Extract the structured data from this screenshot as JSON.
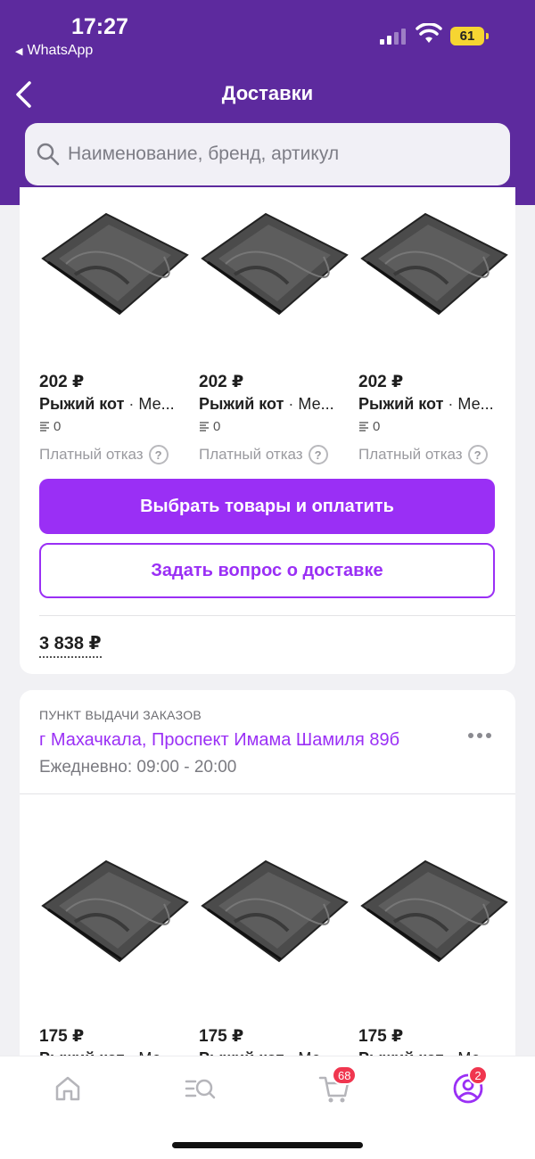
{
  "status_bar": {
    "time": "17:27",
    "back_app": "WhatsApp",
    "battery": "61"
  },
  "header": {
    "title": "Доставки"
  },
  "search": {
    "placeholder": "Наименование, бренд, артикул"
  },
  "delivery1": {
    "products": [
      {
        "price": "202 ₽",
        "brand": "Рыжий кот",
        "sep": " · ",
        "name": "Ме...",
        "stock": "0",
        "refuse": "Платный отказ"
      },
      {
        "price": "202 ₽",
        "brand": "Рыжий кот",
        "sep": " · ",
        "name": "Ме...",
        "stock": "0",
        "refuse": "Платный отказ"
      },
      {
        "price": "202 ₽",
        "brand": "Рыжий кот",
        "sep": " · ",
        "name": "Ме...",
        "stock": "0",
        "refuse": "Платный отказ"
      }
    ],
    "pay_button": "Выбрать товары и оплатить",
    "question_button": "Задать вопрос о доставке",
    "total": "3 838 ₽"
  },
  "delivery2": {
    "pickup_label": "ПУНКТ ВЫДАЧИ ЗАКАЗОВ",
    "address": "г Махачкала, Проспект Имама Шамиля 89б",
    "hours": "Ежедневно: 09:00 - 20:00",
    "products": [
      {
        "price": "175 ₽",
        "brand": "Рыжий кот",
        "name": "Ме..."
      },
      {
        "price": "175 ₽",
        "brand": "Рыжий кот",
        "name": "Ме..."
      },
      {
        "price": "175 ₽",
        "brand": "Рыжий кот",
        "name": "Ме..."
      }
    ]
  },
  "tabbar": {
    "cart_badge": "68",
    "profile_badge": "2"
  },
  "colors": {
    "header": "#5d2a9e",
    "accent": "#9a2ff5",
    "badge": "#f0364f"
  },
  "icons": [
    "back-chevron-icon",
    "search-icon",
    "home-icon",
    "catalog-search-icon",
    "cart-icon",
    "profile-icon",
    "question-icon",
    "more-icon",
    "stock-icon"
  ]
}
